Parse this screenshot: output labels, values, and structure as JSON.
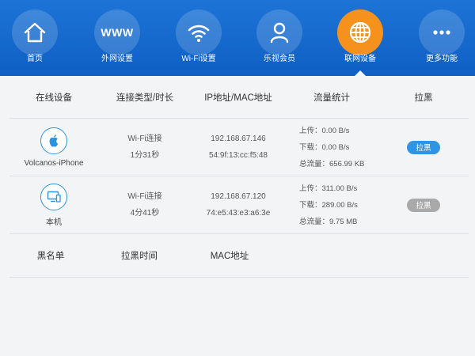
{
  "nav": {
    "items": [
      {
        "label": "首页",
        "icon": "home-icon"
      },
      {
        "label": "外网设置",
        "icon": "www-icon"
      },
      {
        "label": "Wi-Fi设置",
        "icon": "wifi-icon"
      },
      {
        "label": "乐视会员",
        "icon": "user-icon"
      },
      {
        "label": "联网设备",
        "icon": "globe-icon",
        "active": true
      },
      {
        "label": "更多功能",
        "icon": "more-icon"
      }
    ],
    "www_text": "WWW"
  },
  "table": {
    "headers": {
      "device": "在线设备",
      "conn": "连接类型/时长",
      "addr": "IP地址/MAC地址",
      "traffic": "流量统计",
      "block": "拉黑"
    },
    "rows": [
      {
        "icon": "apple-icon",
        "name": "Volcanos-iPhone",
        "conn_type": "Wi-Fi连接",
        "duration": "1分31秒",
        "ip": "192.168.67.146",
        "mac": "54:9f:13:cc:f5:48",
        "upload": "上传：0.00 B/s",
        "download": "下载：0.00 B/s",
        "total": "总流量：656.99 KB",
        "button": "拉黑",
        "button_state": "enabled"
      },
      {
        "icon": "computer-icon",
        "name": "本机",
        "conn_type": "Wi-Fi连接",
        "duration": "4分41秒",
        "ip": "192.168.67.120",
        "mac": "74:e5:43:e3:a6:3e",
        "upload": "上传：311.00 B/s",
        "download": "下载：289.00 B/s",
        "total": "总流量：9.75 MB",
        "button": "拉黑",
        "button_state": "disabled"
      }
    ]
  },
  "blacklist": {
    "headers": {
      "list": "黑名单",
      "time": "拉黑时间",
      "mac": "MAC地址"
    }
  },
  "colors": {
    "nav_bg": "#1567cf",
    "active": "#f5921e",
    "button_blue": "#2e94e6",
    "button_gray": "#a9a9a9"
  }
}
